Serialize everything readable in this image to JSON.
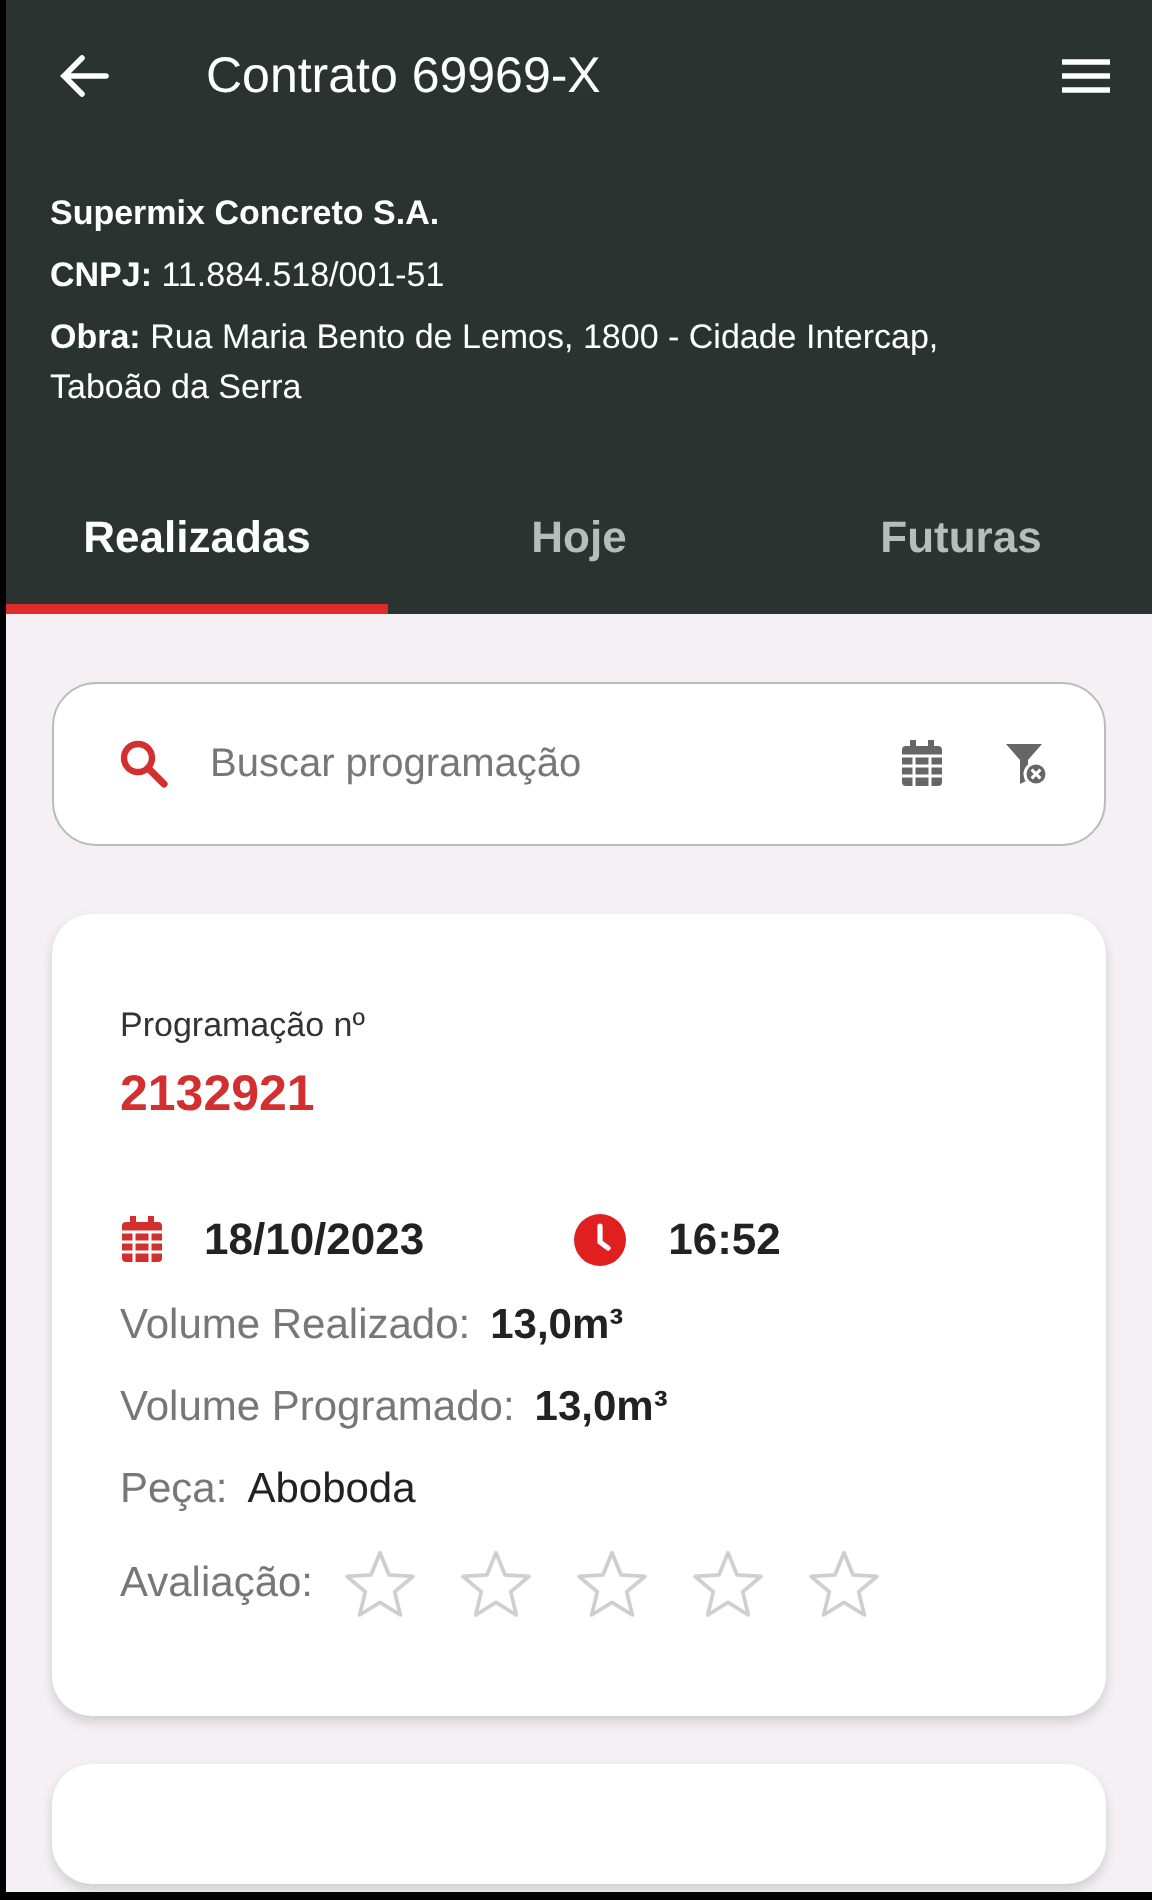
{
  "app_bar": {
    "title": "Contrato 69969-X"
  },
  "contract": {
    "company": "Supermix Concreto S.A.",
    "cnpj": "**CNPJ:** 11.884.518/001-51",
    "site": "**Obra:** Rua Maria Bento de Lemos, 1800 - Cidade Intercap, Taboão da Serra"
  },
  "tabs": [
    {
      "label": "Realizadas",
      "selected": true
    },
    {
      "label": "Hoje",
      "selected": false
    },
    {
      "label": "Futuras",
      "selected": false
    }
  ],
  "search": {
    "placeholder": "Buscar programação"
  },
  "cards": [
    {
      "kind": "schedule",
      "number_label": "Programação nº",
      "number": "2132921",
      "date": "18/10/2023",
      "time": "16:52",
      "fields": [
        {
          "label": "Volume Realizado:",
          "value": "13,0m³",
          "kind": "bold"
        },
        {
          "label": "Volume Programado:",
          "value": "13,0m³",
          "kind": "bold"
        },
        {
          "label": "Peça:",
          "value": "Aboboda",
          "kind": "plain"
        }
      ],
      "rating_label": "Avaliação:",
      "stars": 0
    },
    {
      "kind": "empty"
    }
  ]
}
